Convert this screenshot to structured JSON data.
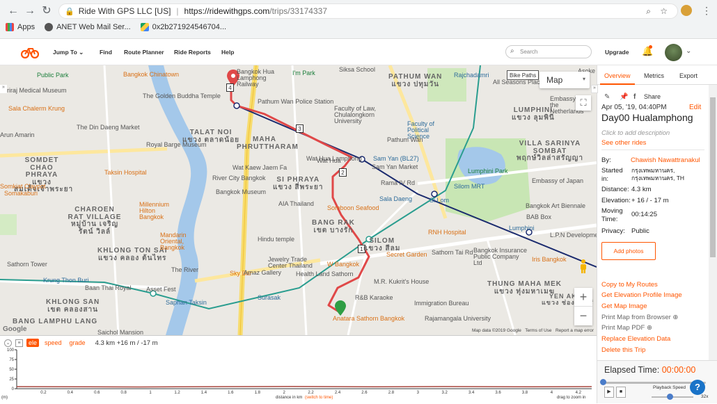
{
  "browser": {
    "back_icon": "arrow-left-icon",
    "url_site_name": "Ride With GPS LLC [US]",
    "url_host": "https://ridewithgps.com",
    "url_path": "/trips/33174337",
    "bookmarks": [
      "Apps",
      "ANET Web Mail Ser...",
      "0x2b271924546704..."
    ]
  },
  "header": {
    "nav": [
      "Jump To",
      "Find",
      "Route Planner",
      "Ride Reports",
      "Help"
    ],
    "search_placeholder": "Search",
    "upgrade": "Upgrade"
  },
  "map": {
    "type_label": "Map",
    "bike_paths": "Bike Paths",
    "attribution": [
      "Map data ©2019 Google",
      "Terms of Use",
      "Report a map error"
    ],
    "google": "Google",
    "labels": [
      "Public Park",
      "Bangkok Chinatown",
      "Siriraj Medical Museum",
      "The Golden Buddha Temple",
      "Sala Chalerm Krung",
      "The Din Daeng Market",
      "Arun Amarin",
      "Royal Barge Museum",
      "Bangkok Hua Lamphong Railway",
      "Pathum Wan Police Station",
      "Faculty of Law, Chulalongkorn University",
      "I'm Park",
      "Siksa School",
      "Faculty of Political Science",
      "Rajchadamri",
      "All Seasons Place",
      "Embassy of the Netherlands",
      "Wat Hua Lamphong",
      "Sam Yan (BL27)",
      "Sam Yan Market",
      "River City Bangkok",
      "Bangkok Museum",
      "AIA Thailand",
      "Somboon Seafood",
      "Sala Daeng",
      "Silom MRT",
      "Lumphini Park",
      "Bangkok Art Biennale",
      "Embassy of Japan",
      "BAB Box",
      "Hindu temple",
      "Jewelry Trade Center Thailand",
      "Health Land Sathorn",
      "W Bangkok",
      "Secret Garden",
      "RNH Hospital",
      "Bangkok Insurance Public Company Ltd",
      "Iris Bangkok",
      "L.P.N Development",
      "Sky Bar",
      "Anatara Sathorn Bangkok",
      "R&B Karaoke",
      "Immigration Bureau",
      "Rajamangala University",
      "Surasak",
      "Saphan Taksin",
      "Sathorn Tower",
      "Krung Thon Buri",
      "Baan Thai Royal",
      "Taksin Hospital",
      "Millennium Hilton Bangkok",
      "Mandarin Oriental, Bangkok",
      "The River",
      "Asset Fest",
      "Saichol Mansion",
      "Wat Kaew Jaem Fa",
      "Rama IV Rd",
      "Sathorn Tai Rd",
      "Si Lom",
      "Silom",
      "Lumphini",
      "Wat Hua",
      "M.R. Kukrit's House",
      "Amaz Gallery",
      "Somkiat Claypot",
      "Somakaburi",
      "Somdet Chao Phraya",
      "Pathum Wan",
      "Asoke"
    ],
    "districts": [
      {
        "en": "PATHUM WAN",
        "th": "แขวง ปทุมวัน"
      },
      {
        "en": "LUMPHINI",
        "th": "แขวง ลุมพินี"
      },
      {
        "en": "TALAT NOI",
        "th": "แขวง ตลาดน้อย"
      },
      {
        "en": "MAHA PHRUTTHARAM",
        "th": ""
      },
      {
        "en": "VILLA SARINYA SOMBAT",
        "th": "พฤกษ์วิลล่าสรัญญา"
      },
      {
        "en": "SI PHRAYA",
        "th": "แขวง สี่พระยา"
      },
      {
        "en": "SOMDET CHAO PHRAYA",
        "th": "แขวง สมเด็จเจ้าพระยา"
      },
      {
        "en": "CHAROEN RAT VILLAGE",
        "th": "หมู่บ้าน เจริญรัตน์ วิลล์"
      },
      {
        "en": "BANG RAK",
        "th": "เขต บางรัก"
      },
      {
        "en": "SILOM",
        "th": "แขวง สีลม"
      },
      {
        "en": "KHLONG TON SAI",
        "th": "แขวง คลอง ต้นไทร"
      },
      {
        "en": "KHLONG SAN",
        "th": "เขต คลองสาน"
      },
      {
        "en": "THUNG MAHA MEK",
        "th": "แขวง ทุ่งมหาเมฆ"
      },
      {
        "en": "YEN AKAT",
        "th": "แขวง ช่องนนทรี"
      },
      {
        "en": "BANG LAMPHU LANG",
        "th": "แขวง บางลำภูล่าง"
      }
    ],
    "route_markers": [
      "4",
      "3",
      "2",
      "1"
    ]
  },
  "elevation": {
    "tabs": [
      "ele",
      "speed",
      "grade"
    ],
    "summary": "4.3 km +16 m / -17 m",
    "y_labels": [
      "100",
      "75",
      "50",
      "25",
      "0"
    ],
    "y_unit": "(m)",
    "x_labels": [
      "0.2",
      "0.4",
      "0.6",
      "0.8",
      "1",
      "1.2",
      "1.4",
      "1.6",
      "1.8",
      "2",
      "2.2",
      "2.4",
      "2.6",
      "2.8",
      "3",
      "3.2",
      "3.4",
      "3.6",
      "3.8",
      "4",
      "4.2"
    ],
    "x_caption": "distance in km",
    "x_switch": "(switch to time)",
    "drag_hint": "drag to zoom in"
  },
  "sidebar": {
    "tabs": [
      "Overview",
      "Metrics",
      "Export"
    ],
    "share": "Share",
    "date": "Apr 05, '19, 04:40PM",
    "edit": "Edit",
    "name": "Day00 Hualamphong",
    "desc_placeholder": "Click to add description",
    "other_rides": "See other rides",
    "rows": [
      {
        "k": "By:",
        "v": "Chawish Nawattranakul"
      },
      {
        "k": "Started in:",
        "v": "กรุงเทพมหานคร, กรุงเทพมหานคร, TH"
      },
      {
        "k": "Distance:",
        "v": "4.3 km"
      },
      {
        "k": "Elevation:",
        "v": "+ 16 / - 17 m"
      },
      {
        "k": "Moving Time:",
        "v": "00:14:25"
      },
      {
        "k": "Privacy:",
        "v": "Public"
      }
    ],
    "add_photos": "Add photos",
    "actions": [
      "Copy to My Routes",
      "Get Elevation Profile Image",
      "Get Map Image",
      "Print Map from Browser",
      "Print Map PDF",
      "Replace Elevation Data",
      "Delete this Trip"
    ],
    "elapsed_label": "Elapsed Time:",
    "elapsed_value": "00:00:00",
    "playback_speed": "Playback Speed",
    "speed_mult": "32x"
  },
  "colors": {
    "accent": "#ff5500",
    "route": "#e04848",
    "bts": "#2a6fd0",
    "mrt": "#1a2a6e",
    "river": "#a4c8ea",
    "park": "#c8e6b4"
  }
}
